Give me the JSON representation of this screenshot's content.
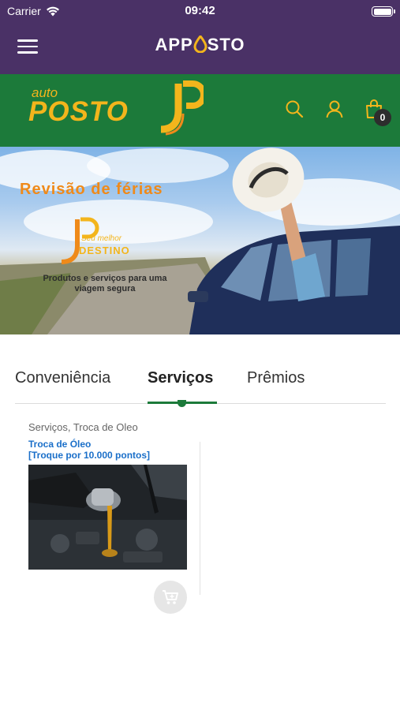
{
  "status_bar": {
    "carrier": "Carrier",
    "time": "09:42"
  },
  "app_bar": {
    "brand_pre": "APP",
    "brand_post": "STO"
  },
  "store": {
    "logo_auto": "auto",
    "logo_posto": "POSTO",
    "cart_count": "0"
  },
  "banner": {
    "headline": "Revisão de férias",
    "slogan_small": "Seu melhor",
    "slogan_big": "DESTINO",
    "tagline": "Produtos e serviços para uma viagem segura"
  },
  "tabs": [
    {
      "label": "Conveniência",
      "active": false
    },
    {
      "label": "Serviços",
      "active": true
    },
    {
      "label": "Prêmios",
      "active": false
    }
  ],
  "product": {
    "category": "Serviços, Troca de Oleo",
    "title_line1": "Troca de Óleo",
    "title_line2": "[Troque por 10.000 pontos]"
  },
  "colors": {
    "app_bar": "#4a3166",
    "store_green": "#1c7a3a",
    "logo_gold": "#f3b51c",
    "banner_orange": "#ef8a1a",
    "link_blue": "#1a6fc9"
  },
  "icons": [
    "wifi-icon",
    "battery-icon",
    "menu-icon",
    "search-icon",
    "user-icon",
    "shopping-bag-icon",
    "add-to-cart-icon"
  ]
}
